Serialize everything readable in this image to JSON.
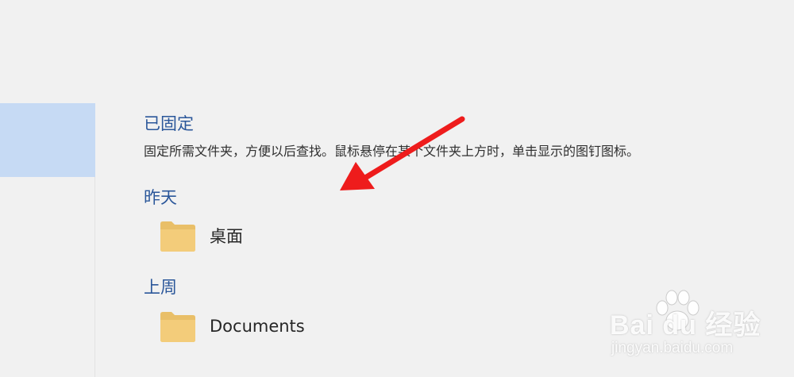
{
  "pinned": {
    "heading": "已固定",
    "description": "固定所需文件夹，方便以后查找。鼠标悬停在某个文件夹上方时，单击显示的图钉图标。"
  },
  "groups": [
    {
      "heading": "昨天",
      "items": [
        {
          "label": "桌面",
          "icon": "folder-icon"
        }
      ]
    },
    {
      "heading": "上周",
      "items": [
        {
          "label": "Documents",
          "icon": "folder-icon"
        }
      ]
    }
  ],
  "annotation": {
    "arrow_color": "#ee1c1c"
  },
  "watermark": {
    "brand": "Bai du 经验",
    "url": "jingyan.baidu.com"
  },
  "colors": {
    "heading": "#2b579a",
    "selected": "#c6daf4",
    "background": "#f1f1f1",
    "folder": "#f3cc7a"
  }
}
